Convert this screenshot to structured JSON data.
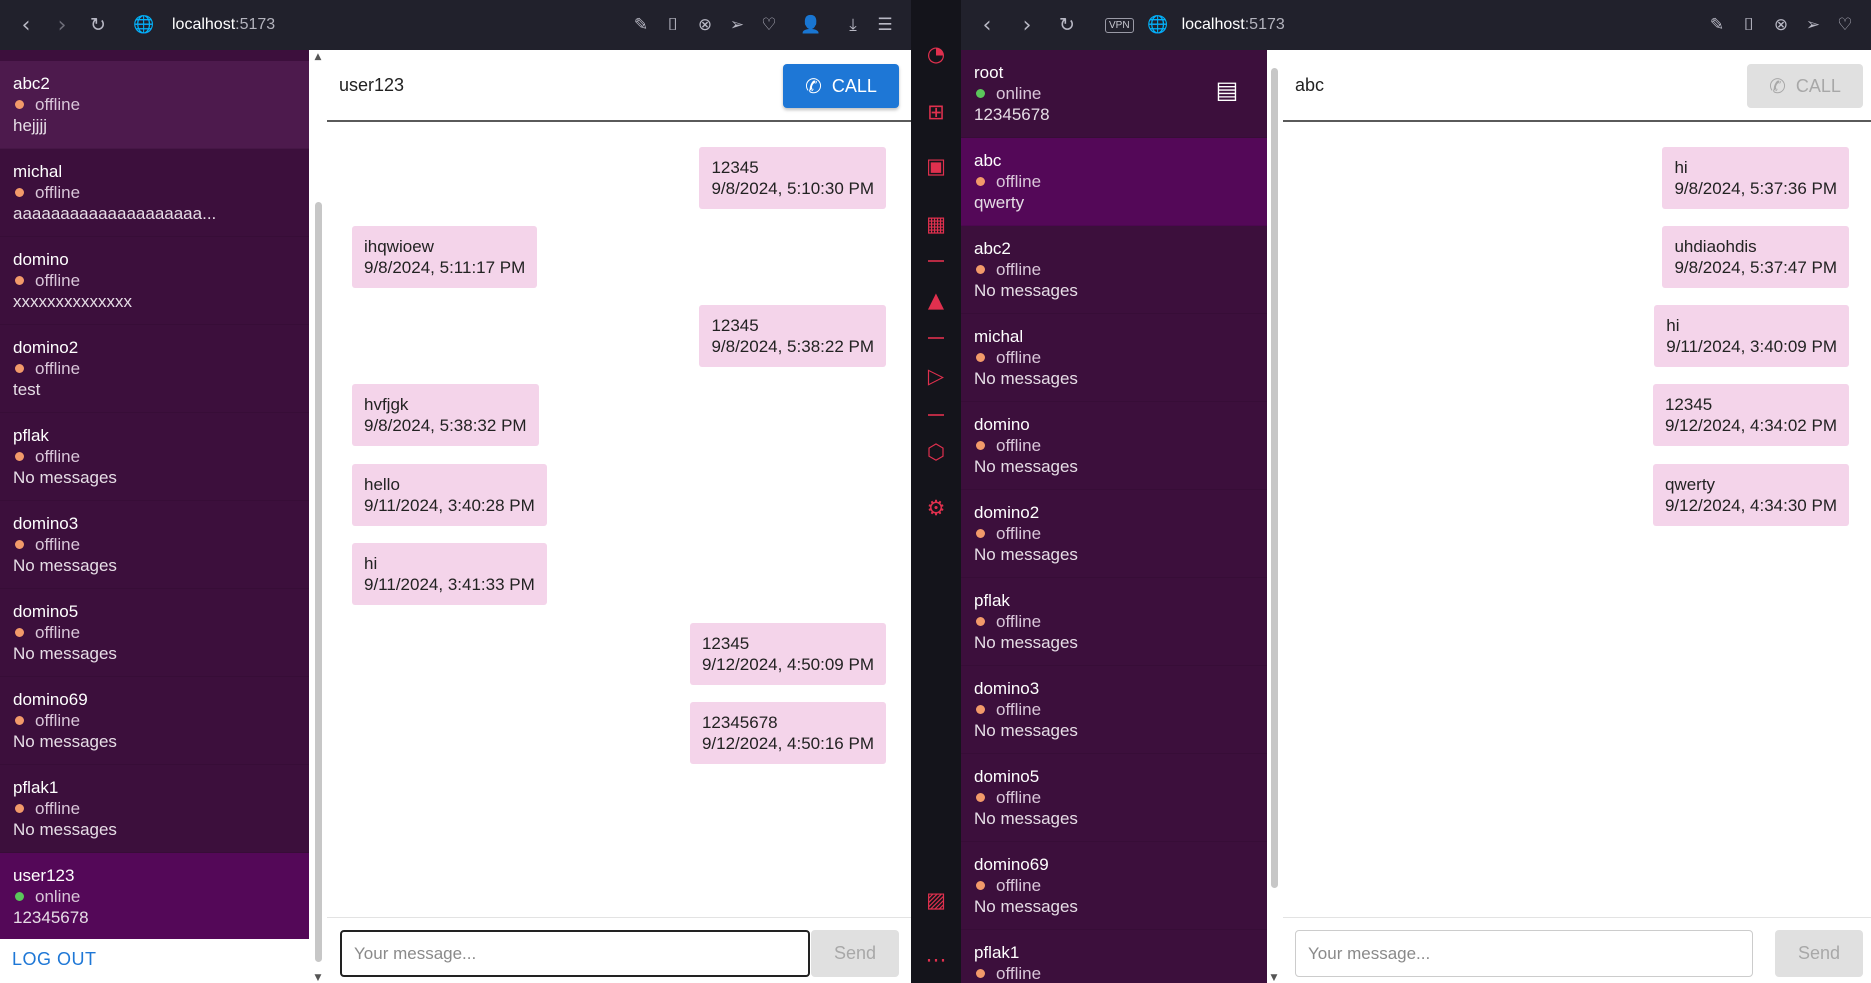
{
  "left": {
    "url_host": "localhost",
    "url_port": ":5173",
    "contacts": [
      {
        "name": "abc2",
        "status": "offline",
        "last": "hejjjj"
      },
      {
        "name": "michal",
        "status": "offline",
        "last": "aaaaaaaaaaaaaaaaaaaa..."
      },
      {
        "name": "domino",
        "status": "offline",
        "last": "xxxxxxxxxxxxxx"
      },
      {
        "name": "domino2",
        "status": "offline",
        "last": "test"
      },
      {
        "name": "pflak",
        "status": "offline",
        "last": "No messages"
      },
      {
        "name": "domino3",
        "status": "offline",
        "last": "No messages"
      },
      {
        "name": "domino5",
        "status": "offline",
        "last": "No messages"
      },
      {
        "name": "domino69",
        "status": "offline",
        "last": "No messages"
      },
      {
        "name": "pflak1",
        "status": "offline",
        "last": "No messages"
      },
      {
        "name": "user123",
        "status": "online",
        "last": "12345678"
      }
    ],
    "logout_label": "LOG OUT",
    "chat": {
      "title": "user123",
      "call_label": "CALL",
      "messages": [
        {
          "text": "12345",
          "time": "9/8/2024, 5:10:30 PM",
          "dir": "out"
        },
        {
          "text": "ihqwioew",
          "time": "9/8/2024, 5:11:17 PM",
          "dir": "in"
        },
        {
          "text": "12345",
          "time": "9/8/2024, 5:38:22 PM",
          "dir": "out"
        },
        {
          "text": "hvfjgk",
          "time": "9/8/2024, 5:38:32 PM",
          "dir": "in"
        },
        {
          "text": "hello",
          "time": "9/11/2024, 3:40:28 PM",
          "dir": "in"
        },
        {
          "text": "hi",
          "time": "9/11/2024, 3:41:33 PM",
          "dir": "in"
        },
        {
          "text": "12345",
          "time": "9/12/2024, 4:50:09 PM",
          "dir": "out"
        },
        {
          "text": "12345678",
          "time": "9/12/2024, 4:50:16 PM",
          "dir": "out"
        }
      ],
      "input_placeholder": "Your message...",
      "send_label": "Send"
    }
  },
  "right": {
    "vpn_label": "VPN",
    "url_host": "localhost",
    "url_port": ":5173",
    "contacts": [
      {
        "name": "root",
        "status": "online",
        "last": "12345678"
      },
      {
        "name": "abc",
        "status": "offline",
        "last": "qwerty"
      },
      {
        "name": "abc2",
        "status": "offline",
        "last": "No messages"
      },
      {
        "name": "michal",
        "status": "offline",
        "last": "No messages"
      },
      {
        "name": "domino",
        "status": "offline",
        "last": "No messages"
      },
      {
        "name": "domino2",
        "status": "offline",
        "last": "No messages"
      },
      {
        "name": "pflak",
        "status": "offline",
        "last": "No messages"
      },
      {
        "name": "domino3",
        "status": "offline",
        "last": "No messages"
      },
      {
        "name": "domino5",
        "status": "offline",
        "last": "No messages"
      },
      {
        "name": "domino69",
        "status": "offline",
        "last": "No messages"
      },
      {
        "name": "pflak1",
        "status": "offline",
        "last": ""
      }
    ],
    "chat": {
      "title": "abc",
      "call_label": "CALL",
      "messages": [
        {
          "text": "hi",
          "time": "9/8/2024, 5:37:36 PM",
          "dir": "out"
        },
        {
          "text": "uhdiaohdis",
          "time": "9/8/2024, 5:37:47 PM",
          "dir": "out"
        },
        {
          "text": "hi",
          "time": "9/11/2024, 3:40:09 PM",
          "dir": "out"
        },
        {
          "text": "12345",
          "time": "9/12/2024, 4:34:02 PM",
          "dir": "out"
        },
        {
          "text": "qwerty",
          "time": "9/12/2024, 4:34:30 PM",
          "dir": "out"
        }
      ],
      "input_placeholder": "Your message...",
      "send_label": "Send"
    }
  },
  "colors": {
    "sidebar_bg": "#3c0f3c",
    "active_contact": "#540858",
    "bubble": "#f4d4ea",
    "call_blue": "#1e77d6",
    "offline_dot": "#f29a6a",
    "online_dot": "#5bc75b",
    "opera_accent": "#e0304e"
  }
}
